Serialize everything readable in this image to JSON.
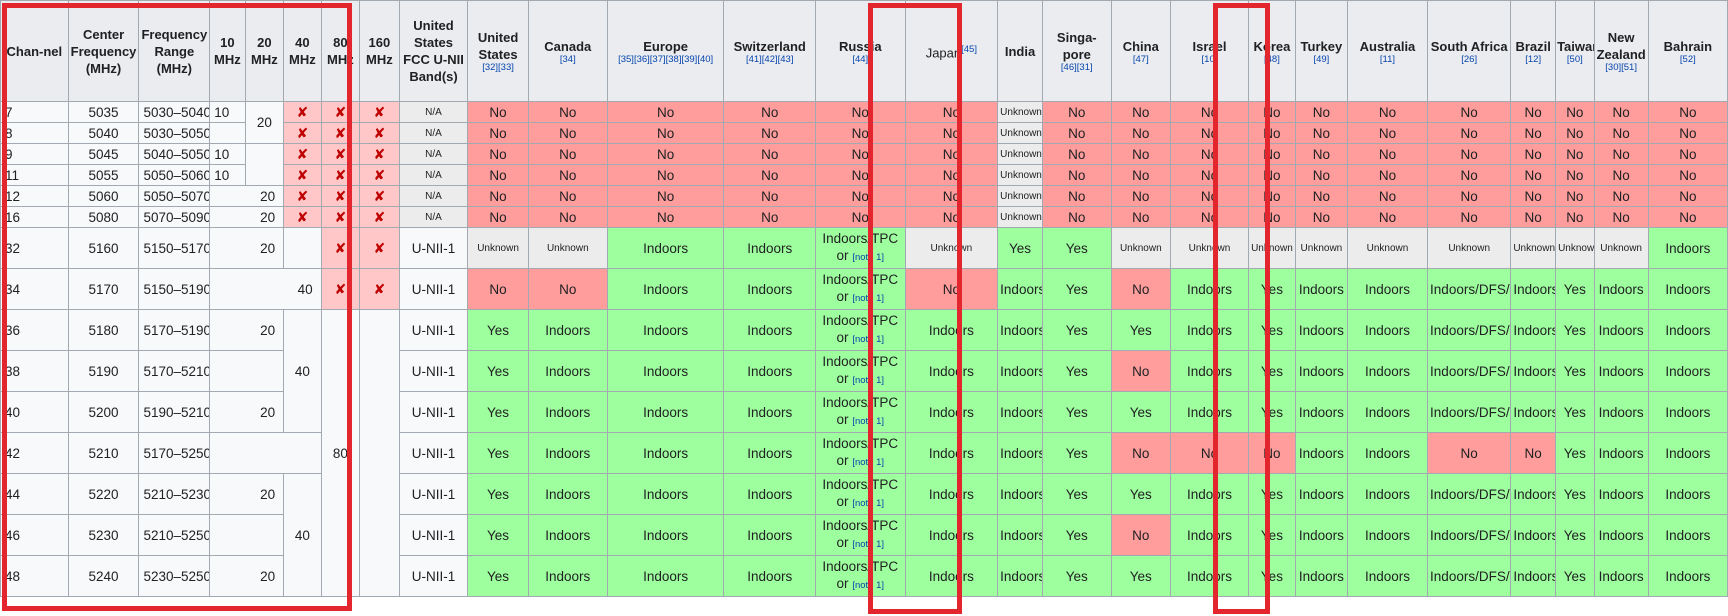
{
  "headers": {
    "channel": "Chan-nel",
    "center": "Center Frequency (MHz)",
    "range": "Frequency Range (MHz)",
    "w10": "10 MHz",
    "w20": "20 MHz",
    "w40": "40 MHz",
    "w80": "80 MHz",
    "w160": "160 MHz",
    "band": "United States FCC U-NII Band(s)",
    "countries": [
      {
        "name": "United States",
        "ref": "[32][33]"
      },
      {
        "name": "Canada",
        "ref": "[34]"
      },
      {
        "name": "Europe",
        "ref": "[35][36][37][38][39][40]"
      },
      {
        "name": "Switzerland",
        "ref": "[41][42][43]"
      },
      {
        "name": "Russia",
        "ref": "[44]"
      },
      {
        "name": "Japan",
        "ref": "[45]"
      },
      {
        "name": "India",
        "ref": ""
      },
      {
        "name": "Singa-pore",
        "ref": "[46][31]"
      },
      {
        "name": "China",
        "ref": "[47]"
      },
      {
        "name": "Israel",
        "ref": "[10]"
      },
      {
        "name": "Korea",
        "ref": "[48]"
      },
      {
        "name": "Turkey",
        "ref": "[49]"
      },
      {
        "name": "Australia",
        "ref": "[11]"
      },
      {
        "name": "South Africa",
        "ref": "[26]"
      },
      {
        "name": "Brazil",
        "ref": "[12]"
      },
      {
        "name": "Taiwan",
        "ref": "[50]"
      },
      {
        "name": "New Zealand",
        "ref": "[30][51]"
      },
      {
        "name": "Bahrain",
        "ref": "[52]"
      }
    ]
  },
  "cell_text": {
    "cross": "✘",
    "na": "N/A",
    "unknown": "Unknown",
    "no": "No",
    "yes": "Yes",
    "indoors": "Indoors",
    "indoors_dfs_tpc": "Indoors/DFS/TPC",
    "indoors_tpc_prefix": "Indoors/TPC or",
    "note": "[note 1]",
    "u_nii_1": "U-NII-1",
    "w10": "10",
    "w20": "20",
    "w40": "40",
    "w80": "80"
  },
  "rows": [
    {
      "channel": "7",
      "center": "5035",
      "range": "5030–5040"
    },
    {
      "channel": "8",
      "center": "5040",
      "range": "5030–5050"
    },
    {
      "channel": "9",
      "center": "5045",
      "range": "5040–5050"
    },
    {
      "channel": "11",
      "center": "5055",
      "range": "5050–5060"
    },
    {
      "channel": "12",
      "center": "5060",
      "range": "5050–5070"
    },
    {
      "channel": "16",
      "center": "5080",
      "range": "5070–5090"
    },
    {
      "channel": "32",
      "center": "5160",
      "range": "5150–5170"
    },
    {
      "channel": "34",
      "center": "5170",
      "range": "5150–5190"
    },
    {
      "channel": "36",
      "center": "5180",
      "range": "5170–5190"
    },
    {
      "channel": "38",
      "center": "5190",
      "range": "5170–5210"
    },
    {
      "channel": "40",
      "center": "5200",
      "range": "5190–5210"
    },
    {
      "channel": "42",
      "center": "5210",
      "range": "5170–5250"
    },
    {
      "channel": "44",
      "center": "5220",
      "range": "5210–5230"
    },
    {
      "channel": "46",
      "center": "5230",
      "range": "5210–5250"
    },
    {
      "channel": "48",
      "center": "5240",
      "range": "5230–5250"
    }
  ],
  "highlight_color": "#e3262d",
  "status_colors": {
    "no": "#ff9c9c",
    "yes": "#9eff9e",
    "unknown": "#ececec"
  }
}
